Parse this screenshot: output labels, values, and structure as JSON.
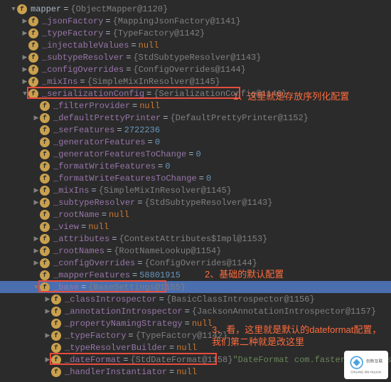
{
  "annotations": {
    "a1": "1、这里就是存放序列化配置",
    "a2": "2、基础的默认配置",
    "a3": "3、看，这里就是默认的dateformat配置，我们第二种就是改这里"
  },
  "watermark": {
    "line1": "创新互联",
    "line2": "CHUANG XIN HULIAN"
  },
  "rows": [
    {
      "d": 0,
      "arr": "open",
      "name": "mapper",
      "val": "{ObjectMapper@1120}",
      "vtype": "obj",
      "nameColor": "#a9b7c6"
    },
    {
      "d": 1,
      "arr": "closed",
      "name": "_jsonFactory",
      "val": "{MappingJsonFactory@1141}",
      "vtype": "obj"
    },
    {
      "d": 1,
      "arr": "closed",
      "name": "_typeFactory",
      "val": "{TypeFactory@1142}",
      "vtype": "obj"
    },
    {
      "d": 1,
      "arr": "none",
      "name": "_injectableValues",
      "val": "null",
      "vtype": "lit"
    },
    {
      "d": 1,
      "arr": "closed",
      "name": "_subtypeResolver",
      "val": "{StdSubtypeResolver@1143}",
      "vtype": "obj"
    },
    {
      "d": 1,
      "arr": "closed",
      "name": "_configOverrides",
      "val": "{ConfigOverrides@1144}",
      "vtype": "obj"
    },
    {
      "d": 1,
      "arr": "closed",
      "name": "_mixIns",
      "val": "{SimpleMixInResolver@1145}",
      "vtype": "obj"
    },
    {
      "d": 1,
      "arr": "open",
      "name": "_serializationConfig",
      "val": "{SerializationConfig@1146}",
      "vtype": "obj",
      "box": true
    },
    {
      "d": 2,
      "arr": "none",
      "name": "_filterProvider",
      "val": "null",
      "vtype": "lit"
    },
    {
      "d": 2,
      "arr": "closed",
      "name": "_defaultPrettyPrinter",
      "val": "{DefaultPrettyPrinter@1152}",
      "vtype": "obj"
    },
    {
      "d": 2,
      "arr": "none",
      "name": "_serFeatures",
      "val": "2722236",
      "vtype": "num"
    },
    {
      "d": 2,
      "arr": "none",
      "name": "_generatorFeatures",
      "val": "0",
      "vtype": "num"
    },
    {
      "d": 2,
      "arr": "none",
      "name": "_generatorFeaturesToChange",
      "val": "0",
      "vtype": "num"
    },
    {
      "d": 2,
      "arr": "none",
      "name": "_formatWriteFeatures",
      "val": "0",
      "vtype": "num"
    },
    {
      "d": 2,
      "arr": "none",
      "name": "_formatWriteFeaturesToChange",
      "val": "0",
      "vtype": "num"
    },
    {
      "d": 2,
      "arr": "closed",
      "name": "_mixIns",
      "val": "{SimpleMixInResolver@1145}",
      "vtype": "obj"
    },
    {
      "d": 2,
      "arr": "closed",
      "name": "_subtypeResolver",
      "val": "{StdSubtypeResolver@1143}",
      "vtype": "obj"
    },
    {
      "d": 2,
      "arr": "none",
      "name": "_rootName",
      "val": "null",
      "vtype": "lit"
    },
    {
      "d": 2,
      "arr": "none",
      "name": "_view",
      "val": "null",
      "vtype": "lit"
    },
    {
      "d": 2,
      "arr": "closed",
      "name": "_attributes",
      "val": "{ContextAttributes$Impl@1153}",
      "vtype": "obj"
    },
    {
      "d": 2,
      "arr": "closed",
      "name": "_rootNames",
      "val": "{RootNameLookup@1154}",
      "vtype": "obj"
    },
    {
      "d": 2,
      "arr": "closed",
      "name": "_configOverrides",
      "val": "{ConfigOverrides@1144}",
      "vtype": "obj"
    },
    {
      "d": 2,
      "arr": "none",
      "name": "_mapperFeatures",
      "val": "58801915",
      "vtype": "num"
    },
    {
      "d": 2,
      "arr": "open",
      "name": "_base",
      "val": "{BaseSettings@1155}",
      "vtype": "obj",
      "selected": true,
      "box": true
    },
    {
      "d": 3,
      "arr": "closed",
      "name": "_classIntrospector",
      "val": "{BasicClassIntrospector@1156}",
      "vtype": "obj"
    },
    {
      "d": 3,
      "arr": "closed",
      "name": "_annotationIntrospector",
      "val": "{JacksonAnnotationIntrospector@1157}",
      "vtype": "obj"
    },
    {
      "d": 3,
      "arr": "none",
      "name": "_propertyNamingStrategy",
      "val": "null",
      "vtype": "lit"
    },
    {
      "d": 3,
      "arr": "closed",
      "name": "_typeFactory",
      "val": "{TypeFactory@1142}",
      "vtype": "obj"
    },
    {
      "d": 3,
      "arr": "none",
      "name": "_typeResolverBuilder",
      "val": "null",
      "vtype": "lit"
    },
    {
      "d": 3,
      "arr": "closed",
      "name": "_dateFormat",
      "val": "{StdDateFormat@1158}",
      "vtype": "obj",
      "extra": "\"DateFormat com.fasterxml.jacks",
      "box": true
    },
    {
      "d": 3,
      "arr": "none",
      "name": "_handlerInstantiator",
      "val": "null",
      "vtype": "lit"
    }
  ]
}
